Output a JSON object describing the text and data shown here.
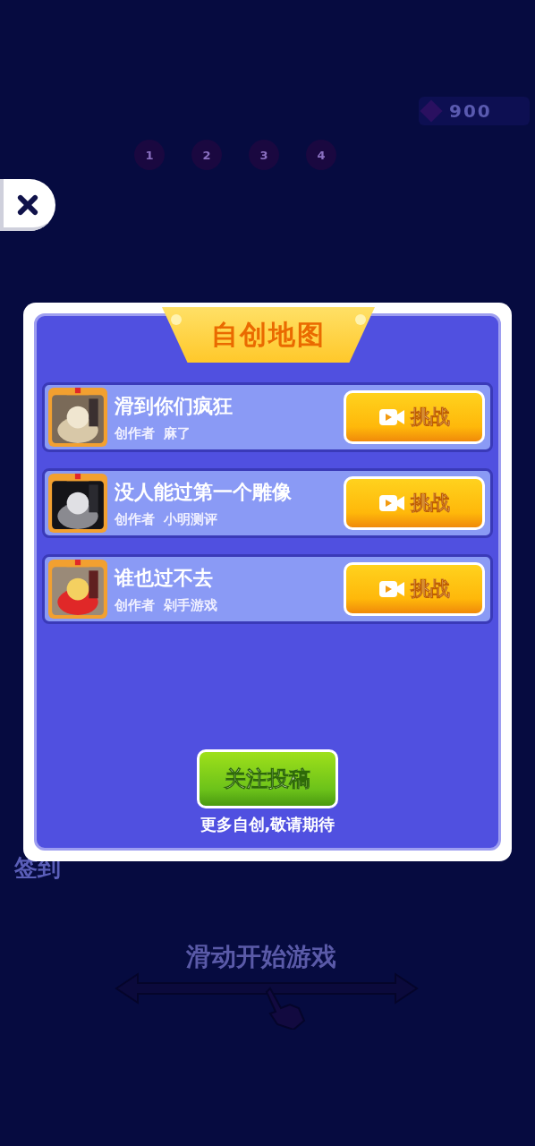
{
  "background": {
    "gems": "900",
    "levels": [
      "1",
      "2",
      "3",
      "4"
    ],
    "sign_in": "签到",
    "swipe_hint": "滑动开始游戏"
  },
  "dialog": {
    "title": "自创地图",
    "maps": [
      {
        "name": "滑到你们疯狂",
        "creator_label": "创作者",
        "creator": "麻了",
        "button": "挑战"
      },
      {
        "name": "没人能过第一个雕像",
        "creator_label": "创作者",
        "creator": "小明测评",
        "button": "挑战"
      },
      {
        "name": "谁也过不去",
        "creator_label": "创作者",
        "creator": "剁手游戏",
        "button": "挑战"
      }
    ],
    "follow_button": "关注投稿",
    "footer": "更多自创,敬请期待"
  }
}
